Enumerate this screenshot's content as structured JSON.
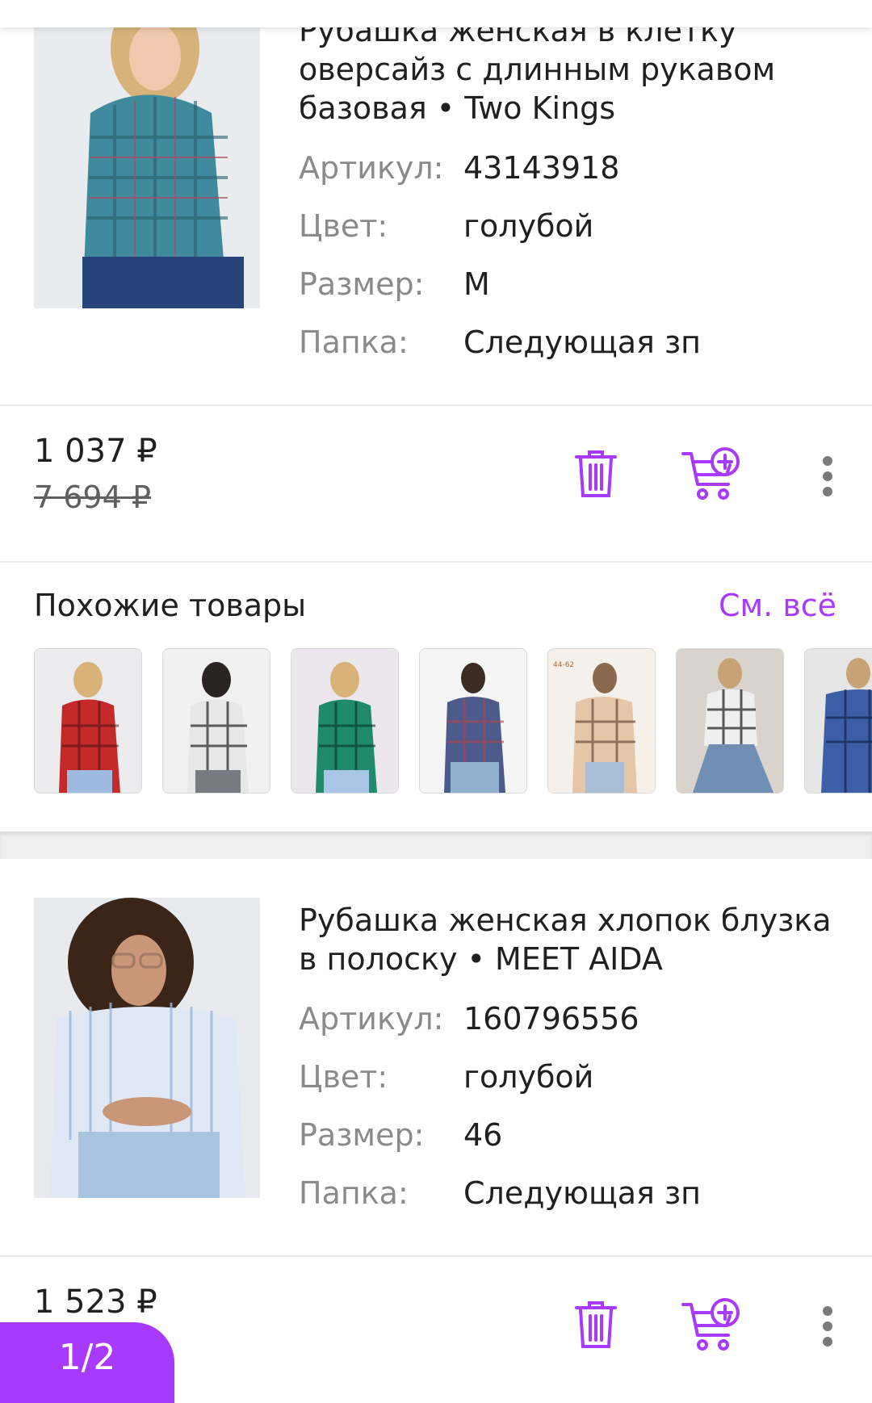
{
  "products": [
    {
      "title_visible": "Рубашка женская в клетку оверсайз с длинным рукавом базовая • Two Kings",
      "title_line1": "Рубашка женская в клетку",
      "title_line2": "оверсайз с длинным рукавом",
      "title_line3": "базовая • Two Kings",
      "specs": [
        {
          "label": "Артикул:",
          "value": "43143918"
        },
        {
          "label": "Цвет:",
          "value": "голубой"
        },
        {
          "label": "Размер:",
          "value": "M"
        },
        {
          "label": "Папка:",
          "value": "Следующая зп"
        }
      ],
      "price": "1 037 ₽",
      "old_price": "7 694 ₽"
    },
    {
      "title_line1": "Рубашка женская хлопок блузка",
      "title_line2": "в полоску • MEET AIDA",
      "specs": [
        {
          "label": "Артикул:",
          "value": "160796556"
        },
        {
          "label": "Цвет:",
          "value": "голубой"
        },
        {
          "label": "Размер:",
          "value": "46"
        },
        {
          "label": "Папка:",
          "value": "Следующая зп"
        }
      ],
      "price": "1 523 ₽"
    }
  ],
  "similar": {
    "title": "Похожие товары",
    "see_all": "См. всё",
    "thumb_label": "44-62"
  },
  "pagination": {
    "label": "1/2"
  },
  "colors": {
    "accent": "#a73afd",
    "divider": "#ececec",
    "muted": "#8a8a8a"
  },
  "icons": [
    "trash-icon",
    "add-to-cart-icon",
    "more-vertical-icon"
  ]
}
